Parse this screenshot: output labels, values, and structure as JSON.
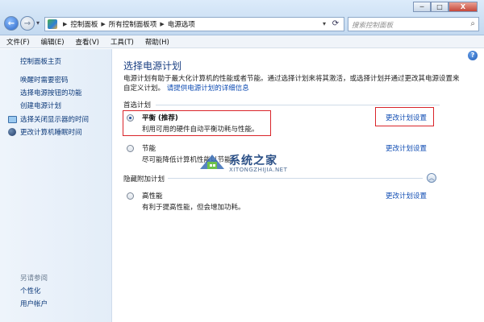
{
  "window": {
    "breadcrumbs": [
      "控制面板",
      "所有控制面板项",
      "电源选项"
    ],
    "search_placeholder": "搜索控制面板",
    "buttons": {
      "minimize": "─",
      "maximize": "□",
      "close": "X"
    }
  },
  "menu": [
    "文件(F)",
    "编辑(E)",
    "查看(V)",
    "工具(T)",
    "帮助(H)"
  ],
  "sidebar": {
    "home": "控制面板主页",
    "links": [
      "唤醒时需要密码",
      "选择电源按钮的功能",
      "创建电源计划"
    ],
    "icon_links": [
      {
        "label": "选择关闭显示器的时间",
        "icon": "monitor-icon"
      },
      {
        "label": "更改计算机睡眠时间",
        "icon": "moon-icon"
      }
    ],
    "see_also_title": "另请参阅",
    "see_also": [
      "个性化",
      "用户帐户"
    ]
  },
  "main": {
    "title": "选择电源计划",
    "description": "电源计划有助于最大化计算机的性能或者节能。通过选择计划来将其激活，或选择计划并通过更改其电源设置来自定义计划。",
    "description_link": "请提供电源计划的详细信息",
    "preferred_label": "首选计划",
    "hidden_label": "隐藏附加计划",
    "change_label": "更改计划设置",
    "plans": [
      {
        "name": "平衡 (推荐)",
        "desc": "利用可用的硬件自动平衡功耗与性能。",
        "selected": true
      },
      {
        "name": "节能",
        "desc": "尽可能降低计算机性能以节能。",
        "selected": false
      },
      {
        "name": "高性能",
        "desc": "有利于提高性能，但会增加功耗。",
        "selected": false
      }
    ]
  },
  "watermark": {
    "text": "系统之家",
    "url": "XITONGZHIJIA.NET"
  },
  "colors": {
    "link": "#0f4cb3",
    "heading": "#1a3f82",
    "highlight": "#d9242a"
  }
}
